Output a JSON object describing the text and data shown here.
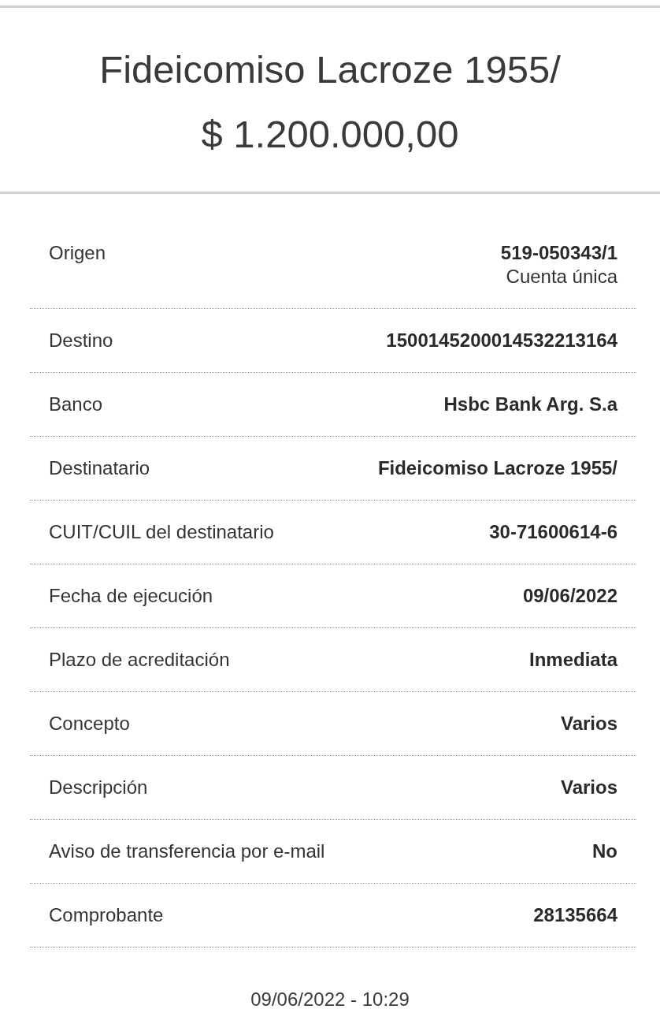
{
  "header": {
    "title": "Fideicomiso Lacroze 1955/",
    "amount": "$ 1.200.000,00"
  },
  "details": [
    {
      "label": "Origen",
      "value": "519-050343/1",
      "note": "Cuenta única"
    },
    {
      "label": "Destino",
      "value": "1500145200014532213164"
    },
    {
      "label": "Banco",
      "value": "Hsbc Bank Arg. S.a"
    },
    {
      "label": "Destinatario",
      "value": "Fideicomiso Lacroze 1955/"
    },
    {
      "label": "CUIT/CUIL del destinatario",
      "value": "30-71600614-6"
    },
    {
      "label": "Fecha de ejecución",
      "value": "09/06/2022"
    },
    {
      "label": "Plazo de acreditación",
      "value": "Inmediata"
    },
    {
      "label": "Concepto",
      "value": "Varios"
    },
    {
      "label": "Descripción",
      "value": "Varios"
    },
    {
      "label": "Aviso de transferencia por e-mail",
      "value": "No"
    },
    {
      "label": "Comprobante",
      "value": "28135664"
    }
  ],
  "footer": {
    "timestamp": "09/06/2022 - 10:29"
  }
}
